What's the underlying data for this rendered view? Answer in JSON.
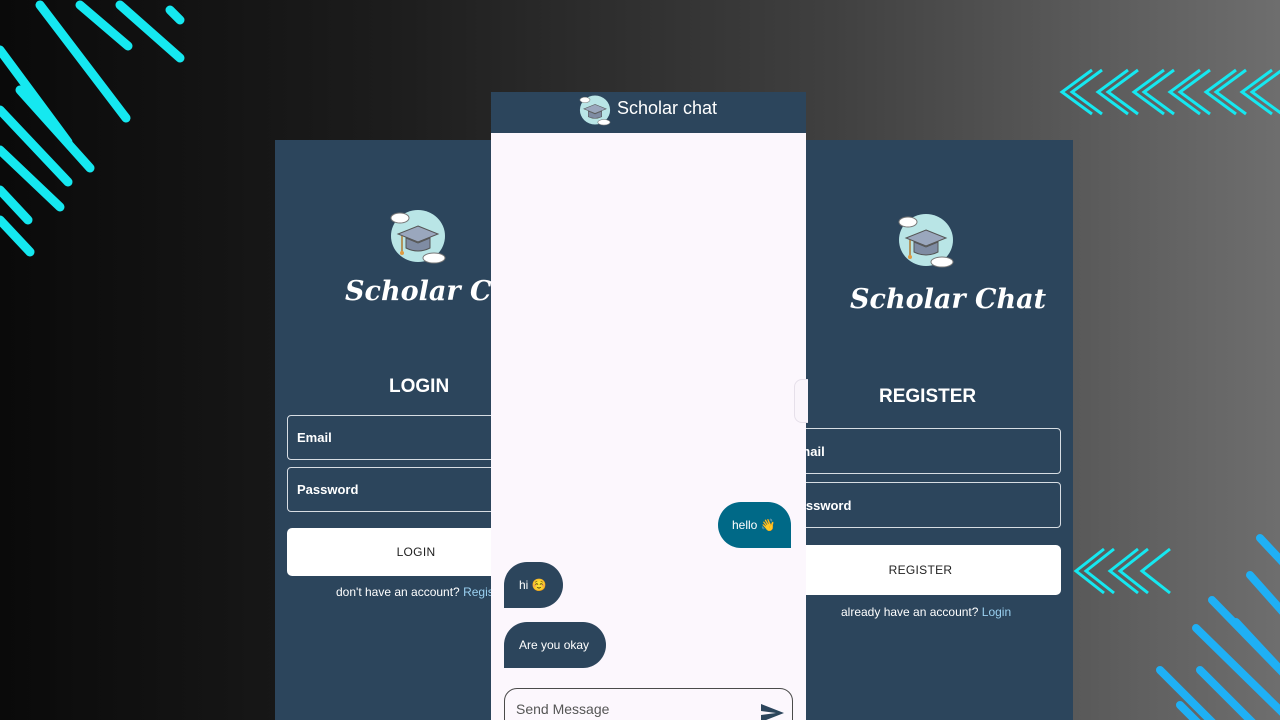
{
  "login": {
    "brand": "Scholar Chat",
    "title": "LOGIN",
    "email_placeholder": "Email",
    "password_placeholder": "Password",
    "button_label": "LOGIN",
    "switch_text": "don't have an account? ",
    "switch_link": "Register"
  },
  "register": {
    "brand": "Scholar Chat",
    "title": "REGISTER",
    "email_placeholder": "Email",
    "password_placeholder": "Password",
    "button_label": "REGISTER",
    "switch_text": "already have an account? ",
    "switch_link": "Login"
  },
  "chat": {
    "title": "Scholar chat",
    "messages": [
      {
        "text": "hello 👋",
        "direction": "sent"
      },
      {
        "text": "hi ☺️",
        "direction": "received"
      },
      {
        "text": "Are you okay",
        "direction": "received"
      }
    ],
    "input_placeholder": "Send Message"
  },
  "icons": {
    "logo": "graduation-cap-cloud-icon",
    "send": "send-arrow-icon"
  },
  "colors": {
    "panel": "#2c455c",
    "sent_bubble": "#006987",
    "received_bubble": "#2c455c",
    "chat_background": "#fcf7fd",
    "accent_cyan": "#15e8f0",
    "accent_blue": "#1fb0f5"
  }
}
